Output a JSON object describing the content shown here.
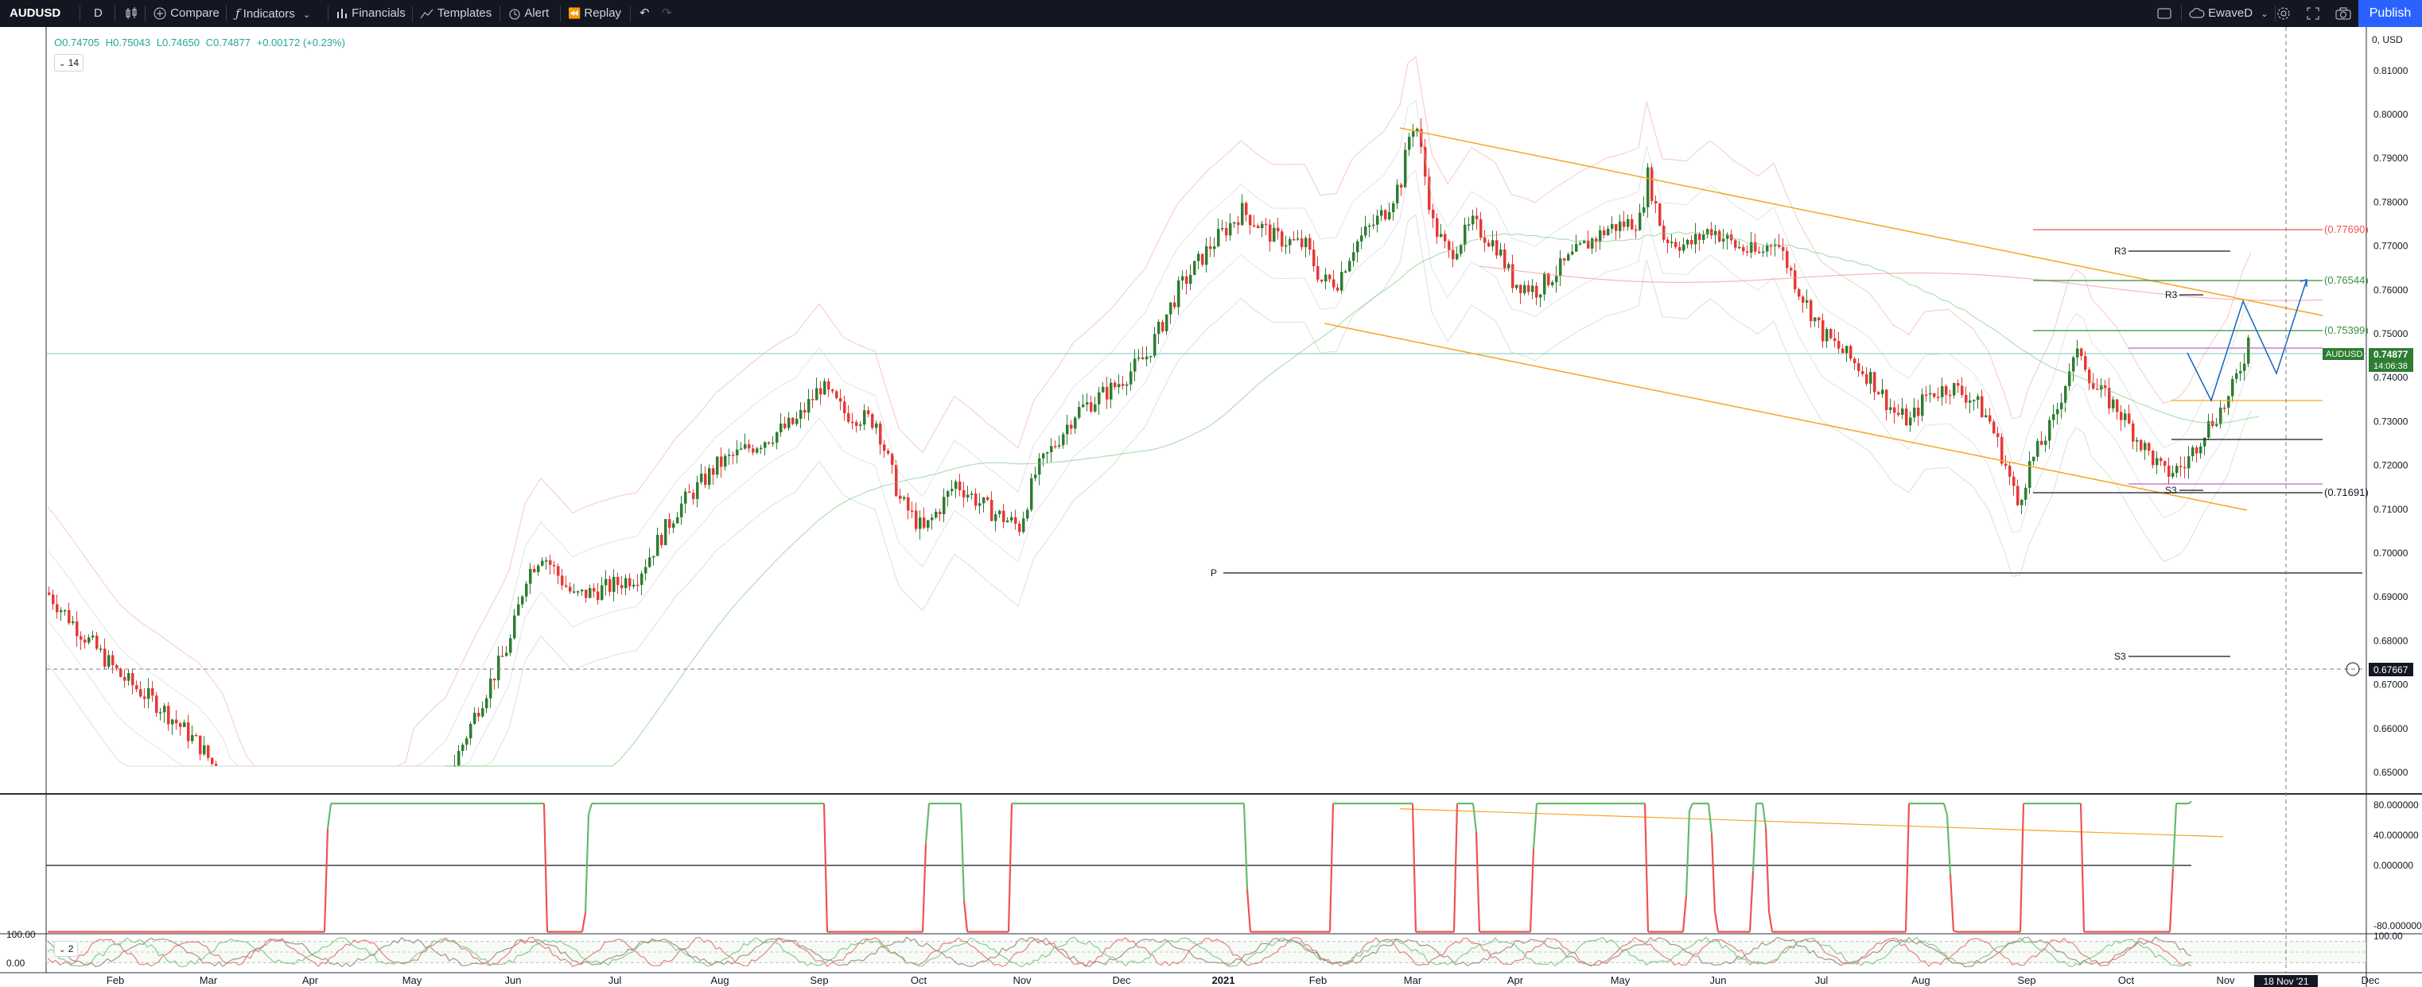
{
  "toolbar": {
    "symbol": "AUDUSD",
    "interval": "D",
    "compare": "Compare",
    "indicators": "Indicators",
    "financials": "Financials",
    "templates": "Templates",
    "alert": "Alert",
    "replay": "Replay",
    "layout_name": "EwaveD",
    "publish": "Publish"
  },
  "legend": {
    "open": "O0.74705",
    "high": "H0.75043",
    "low": "L0.74650",
    "close": "C0.74877",
    "change": "+0.00172 (+0.23%)",
    "indicator_badge": "14",
    "sub_badge": "2"
  },
  "price_scale": {
    "currency": "0, USD",
    "labels": [
      "0.81000",
      "0.80000",
      "0.79000",
      "0.78000",
      "0.77000",
      "0.76000",
      "0.75000",
      "0.74000",
      "0.73000",
      "0.72000",
      "0.71000",
      "0.70000",
      "0.69000",
      "0.68000",
      "0.67000",
      "0.66000",
      "0.65000"
    ],
    "current_price": "0.74877",
    "countdown": "14:06:38",
    "symbol_tag": "AUDUSD",
    "crosshair_price": "0.67667"
  },
  "osc_scale": {
    "labels": [
      "80.000000",
      "40.000000",
      "0.000000",
      "-80.000000"
    ],
    "stoch_labels": [
      "100.00",
      "100.00",
      "0.00"
    ]
  },
  "fib_labels": {
    "r_7769": "(0.77690)",
    "r_7654": "(0.76544)",
    "r_7540": "(0.75399)",
    "r_7169": "(0.71691)"
  },
  "pivot_labels": {
    "p": "P",
    "r3a": "R3",
    "r3b": "R3",
    "s3a": "S3",
    "s3b": "S3"
  },
  "time_axis": {
    "labels": [
      "Feb",
      "Mar",
      "Apr",
      "May",
      "Jun",
      "Jul",
      "Aug",
      "Sep",
      "Oct",
      "Nov",
      "Dec",
      "2021",
      "Feb",
      "Mar",
      "Apr",
      "May",
      "Jun",
      "Jul",
      "Aug",
      "Sep",
      "Oct",
      "Nov",
      "Dec"
    ],
    "crosshair_date": "18 Nov '21"
  },
  "colors": {
    "up": "#26a69a",
    "down": "#ef5350",
    "candle_up": "#2e7d32",
    "candle_down": "#e53935",
    "channel": "#f5a623",
    "fib_green": "#388e3c",
    "fib_red": "#ef5350",
    "projection": "#1565c0",
    "toolbar_bg": "#131722",
    "publish": "#2962ff"
  }
}
